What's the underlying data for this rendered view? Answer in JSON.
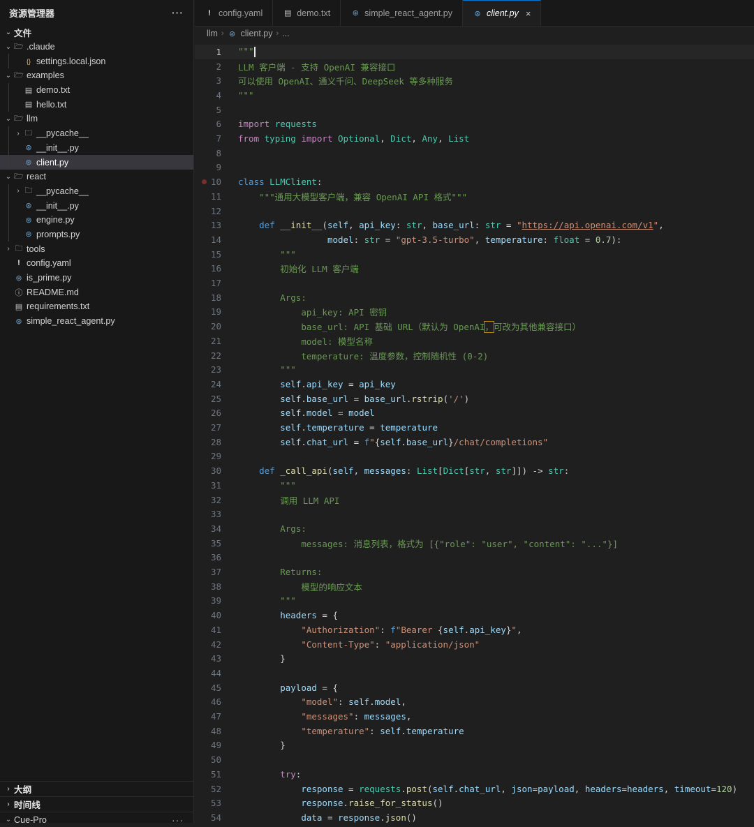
{
  "sidebar": {
    "title": "资源管理器",
    "more": "···",
    "section_files": "文件",
    "tree": [
      {
        "label": ".claude",
        "depth": 1,
        "type": "folder",
        "open": true
      },
      {
        "label": "settings.local.json",
        "depth": 2,
        "type": "json"
      },
      {
        "label": "examples",
        "depth": 1,
        "type": "folder",
        "open": true
      },
      {
        "label": "demo.txt",
        "depth": 2,
        "type": "txt"
      },
      {
        "label": "hello.txt",
        "depth": 2,
        "type": "txt"
      },
      {
        "label": "llm",
        "depth": 1,
        "type": "folder",
        "open": true
      },
      {
        "label": "__pycache__",
        "depth": 2,
        "type": "folder",
        "open": false
      },
      {
        "label": "__init__.py",
        "depth": 2,
        "type": "py"
      },
      {
        "label": "client.py",
        "depth": 2,
        "type": "py",
        "active": true
      },
      {
        "label": "react",
        "depth": 1,
        "type": "folder",
        "open": true
      },
      {
        "label": "__pycache__",
        "depth": 2,
        "type": "folder",
        "open": false
      },
      {
        "label": "__init__.py",
        "depth": 2,
        "type": "py"
      },
      {
        "label": "engine.py",
        "depth": 2,
        "type": "py"
      },
      {
        "label": "prompts.py",
        "depth": 2,
        "type": "py"
      },
      {
        "label": "tools",
        "depth": 1,
        "type": "folder",
        "open": false
      },
      {
        "label": "config.yaml",
        "depth": 1,
        "type": "yaml"
      },
      {
        "label": "is_prime.py",
        "depth": 1,
        "type": "py"
      },
      {
        "label": "README.md",
        "depth": 1,
        "type": "md"
      },
      {
        "label": "requirements.txt",
        "depth": 1,
        "type": "txt"
      },
      {
        "label": "simple_react_agent.py",
        "depth": 1,
        "type": "py"
      }
    ],
    "section_outline": "大纲",
    "section_timeline": "时间线",
    "section_cue": "Cue-Pro"
  },
  "tabs": [
    {
      "label": "config.yaml",
      "type": "yaml"
    },
    {
      "label": "demo.txt",
      "type": "txt"
    },
    {
      "label": "simple_react_agent.py",
      "type": "py"
    },
    {
      "label": "client.py",
      "type": "py",
      "active": true
    }
  ],
  "breadcrumb": {
    "folder": "llm",
    "file": "client.py",
    "more": "..."
  },
  "colors": {
    "accent": "#0078d4",
    "background": "#1f1f1f",
    "sidebar": "#181818"
  },
  "editor": {
    "current_line": 1,
    "breakpoint_line": 10,
    "lines": [
      [
        [
          "d",
          "\"\"\""
        ]
      ],
      [
        [
          "d",
          "LLM 客户端 - 支持 OpenAI 兼容接口"
        ]
      ],
      [
        [
          "d",
          "可以使用 OpenAI、通义千问、DeepSeek 等多种服务"
        ]
      ],
      [
        [
          "d",
          "\"\"\""
        ]
      ],
      [],
      [
        [
          "k",
          "import"
        ],
        [
          "t",
          " "
        ],
        [
          "c",
          "requests"
        ]
      ],
      [
        [
          "k",
          "from"
        ],
        [
          "t",
          " "
        ],
        [
          "c",
          "typing"
        ],
        [
          "t",
          " "
        ],
        [
          "k",
          "import"
        ],
        [
          "t",
          " "
        ],
        [
          "c",
          "Optional"
        ],
        [
          "t",
          ", "
        ],
        [
          "c",
          "Dict"
        ],
        [
          "t",
          ", "
        ],
        [
          "c",
          "Any"
        ],
        [
          "t",
          ", "
        ],
        [
          "c",
          "List"
        ]
      ],
      [],
      [],
      [
        [
          "b",
          "class"
        ],
        [
          "t",
          " "
        ],
        [
          "c",
          "LLMClient"
        ],
        [
          "t",
          ":"
        ]
      ],
      [
        [
          "t",
          "    "
        ],
        [
          "d",
          "\"\"\"通用大模型客户端，兼容 OpenAI API 格式\"\"\""
        ]
      ],
      [],
      [
        [
          "t",
          "    "
        ],
        [
          "b",
          "def"
        ],
        [
          "t",
          " "
        ],
        [
          "f",
          "__init__"
        ],
        [
          "t",
          "("
        ],
        [
          "p",
          "self"
        ],
        [
          "t",
          ", "
        ],
        [
          "p",
          "api_key"
        ],
        [
          "t",
          ": "
        ],
        [
          "c",
          "str"
        ],
        [
          "t",
          ", "
        ],
        [
          "p",
          "base_url"
        ],
        [
          "t",
          ": "
        ],
        [
          "c",
          "str"
        ],
        [
          "t",
          " = "
        ],
        [
          "s",
          "\""
        ],
        [
          "u",
          "https://api.openai.com/v1"
        ],
        [
          "s",
          "\""
        ],
        [
          "t",
          ","
        ]
      ],
      [
        [
          "t",
          "                 "
        ],
        [
          "p",
          "model"
        ],
        [
          "t",
          ": "
        ],
        [
          "c",
          "str"
        ],
        [
          "t",
          " = "
        ],
        [
          "s",
          "\"gpt-3.5-turbo\""
        ],
        [
          "t",
          ", "
        ],
        [
          "p",
          "temperature"
        ],
        [
          "t",
          ": "
        ],
        [
          "c",
          "float"
        ],
        [
          "t",
          " = "
        ],
        [
          "n",
          "0.7"
        ],
        [
          "t",
          "):"
        ]
      ],
      [
        [
          "t",
          "        "
        ],
        [
          "d",
          "\"\"\""
        ]
      ],
      [
        [
          "t",
          "        "
        ],
        [
          "d",
          "初始化 LLM 客户端"
        ]
      ],
      [],
      [
        [
          "t",
          "        "
        ],
        [
          "d",
          "Args:"
        ]
      ],
      [
        [
          "t",
          "            "
        ],
        [
          "d",
          "api_key: API 密钥"
        ]
      ],
      [
        [
          "t",
          "            "
        ],
        [
          "d",
          "base_url: API 基础 URL（默认为 OpenAI"
        ],
        [
          "h",
          "，"
        ],
        [
          "d",
          "可改为其他兼容接口）"
        ]
      ],
      [
        [
          "t",
          "            "
        ],
        [
          "d",
          "model: 模型名称"
        ]
      ],
      [
        [
          "t",
          "            "
        ],
        [
          "d",
          "temperature: 温度参数，控制随机性 (0-2)"
        ]
      ],
      [
        [
          "t",
          "        "
        ],
        [
          "d",
          "\"\"\""
        ]
      ],
      [
        [
          "t",
          "        "
        ],
        [
          "p",
          "self"
        ],
        [
          "t",
          "."
        ],
        [
          "p",
          "api_key"
        ],
        [
          "t",
          " = "
        ],
        [
          "p",
          "api_key"
        ]
      ],
      [
        [
          "t",
          "        "
        ],
        [
          "p",
          "self"
        ],
        [
          "t",
          "."
        ],
        [
          "p",
          "base_url"
        ],
        [
          "t",
          " = "
        ],
        [
          "p",
          "base_url"
        ],
        [
          "t",
          "."
        ],
        [
          "f",
          "rstrip"
        ],
        [
          "t",
          "("
        ],
        [
          "s",
          "'/'"
        ],
        [
          "t",
          ")"
        ]
      ],
      [
        [
          "t",
          "        "
        ],
        [
          "p",
          "self"
        ],
        [
          "t",
          "."
        ],
        [
          "p",
          "model"
        ],
        [
          "t",
          " = "
        ],
        [
          "p",
          "model"
        ]
      ],
      [
        [
          "t",
          "        "
        ],
        [
          "p",
          "self"
        ],
        [
          "t",
          "."
        ],
        [
          "p",
          "temperature"
        ],
        [
          "t",
          " = "
        ],
        [
          "p",
          "temperature"
        ]
      ],
      [
        [
          "t",
          "        "
        ],
        [
          "p",
          "self"
        ],
        [
          "t",
          "."
        ],
        [
          "p",
          "chat_url"
        ],
        [
          "t",
          " = "
        ],
        [
          "b",
          "f"
        ],
        [
          "s",
          "\""
        ],
        [
          "t",
          "{"
        ],
        [
          "p",
          "self"
        ],
        [
          "t",
          "."
        ],
        [
          "p",
          "base_url"
        ],
        [
          "t",
          "}"
        ],
        [
          "s",
          "/chat/completions\""
        ]
      ],
      [],
      [
        [
          "t",
          "    "
        ],
        [
          "b",
          "def"
        ],
        [
          "t",
          " "
        ],
        [
          "f",
          "_call_api"
        ],
        [
          "t",
          "("
        ],
        [
          "p",
          "self"
        ],
        [
          "t",
          ", "
        ],
        [
          "p",
          "messages"
        ],
        [
          "t",
          ": "
        ],
        [
          "c",
          "List"
        ],
        [
          "t",
          "["
        ],
        [
          "c",
          "Dict"
        ],
        [
          "t",
          "["
        ],
        [
          "c",
          "str"
        ],
        [
          "t",
          ", "
        ],
        [
          "c",
          "str"
        ],
        [
          "t",
          "]]) -> "
        ],
        [
          "c",
          "str"
        ],
        [
          "t",
          ":"
        ]
      ],
      [
        [
          "t",
          "        "
        ],
        [
          "d",
          "\"\"\""
        ]
      ],
      [
        [
          "t",
          "        "
        ],
        [
          "d",
          "调用 LLM API"
        ]
      ],
      [],
      [
        [
          "t",
          "        "
        ],
        [
          "d",
          "Args:"
        ]
      ],
      [
        [
          "t",
          "            "
        ],
        [
          "d",
          "messages: 消息列表，格式为 [{\"role\": \"user\", \"content\": \"...\"}]"
        ]
      ],
      [],
      [
        [
          "t",
          "        "
        ],
        [
          "d",
          "Returns:"
        ]
      ],
      [
        [
          "t",
          "            "
        ],
        [
          "d",
          "模型的响应文本"
        ]
      ],
      [
        [
          "t",
          "        "
        ],
        [
          "d",
          "\"\"\""
        ]
      ],
      [
        [
          "t",
          "        "
        ],
        [
          "p",
          "headers"
        ],
        [
          "t",
          " = {"
        ]
      ],
      [
        [
          "t",
          "            "
        ],
        [
          "s",
          "\"Authorization\""
        ],
        [
          "t",
          ": "
        ],
        [
          "b",
          "f"
        ],
        [
          "s",
          "\"Bearer "
        ],
        [
          "t",
          "{"
        ],
        [
          "p",
          "self"
        ],
        [
          "t",
          "."
        ],
        [
          "p",
          "api_key"
        ],
        [
          "t",
          "}"
        ],
        [
          "s",
          "\""
        ],
        [
          "t",
          ","
        ]
      ],
      [
        [
          "t",
          "            "
        ],
        [
          "s",
          "\"Content-Type\""
        ],
        [
          "t",
          ": "
        ],
        [
          "s",
          "\"application/json\""
        ]
      ],
      [
        [
          "t",
          "        }"
        ]
      ],
      [],
      [
        [
          "t",
          "        "
        ],
        [
          "p",
          "payload"
        ],
        [
          "t",
          " = {"
        ]
      ],
      [
        [
          "t",
          "            "
        ],
        [
          "s",
          "\"model\""
        ],
        [
          "t",
          ": "
        ],
        [
          "p",
          "self"
        ],
        [
          "t",
          "."
        ],
        [
          "p",
          "model"
        ],
        [
          "t",
          ","
        ]
      ],
      [
        [
          "t",
          "            "
        ],
        [
          "s",
          "\"messages\""
        ],
        [
          "t",
          ": "
        ],
        [
          "p",
          "messages"
        ],
        [
          "t",
          ","
        ]
      ],
      [
        [
          "t",
          "            "
        ],
        [
          "s",
          "\"temperature\""
        ],
        [
          "t",
          ": "
        ],
        [
          "p",
          "self"
        ],
        [
          "t",
          "."
        ],
        [
          "p",
          "temperature"
        ]
      ],
      [
        [
          "t",
          "        }"
        ]
      ],
      [],
      [
        [
          "t",
          "        "
        ],
        [
          "k",
          "try"
        ],
        [
          "t",
          ":"
        ]
      ],
      [
        [
          "t",
          "            "
        ],
        [
          "p",
          "response"
        ],
        [
          "t",
          " = "
        ],
        [
          "c",
          "requests"
        ],
        [
          "t",
          "."
        ],
        [
          "f",
          "post"
        ],
        [
          "t",
          "("
        ],
        [
          "p",
          "self"
        ],
        [
          "t",
          "."
        ],
        [
          "p",
          "chat_url"
        ],
        [
          "t",
          ", "
        ],
        [
          "p",
          "json"
        ],
        [
          "t",
          "="
        ],
        [
          "p",
          "payload"
        ],
        [
          "t",
          ", "
        ],
        [
          "p",
          "headers"
        ],
        [
          "t",
          "="
        ],
        [
          "p",
          "headers"
        ],
        [
          "t",
          ", "
        ],
        [
          "p",
          "timeout"
        ],
        [
          "t",
          "="
        ],
        [
          "n",
          "120"
        ],
        [
          "t",
          ")"
        ]
      ],
      [
        [
          "t",
          "            "
        ],
        [
          "p",
          "response"
        ],
        [
          "t",
          "."
        ],
        [
          "f",
          "raise_for_status"
        ],
        [
          "t",
          "()"
        ]
      ],
      [
        [
          "t",
          "            "
        ],
        [
          "p",
          "data"
        ],
        [
          "t",
          " = "
        ],
        [
          "p",
          "response"
        ],
        [
          "t",
          "."
        ],
        [
          "f",
          "json"
        ],
        [
          "t",
          "()"
        ]
      ]
    ]
  }
}
